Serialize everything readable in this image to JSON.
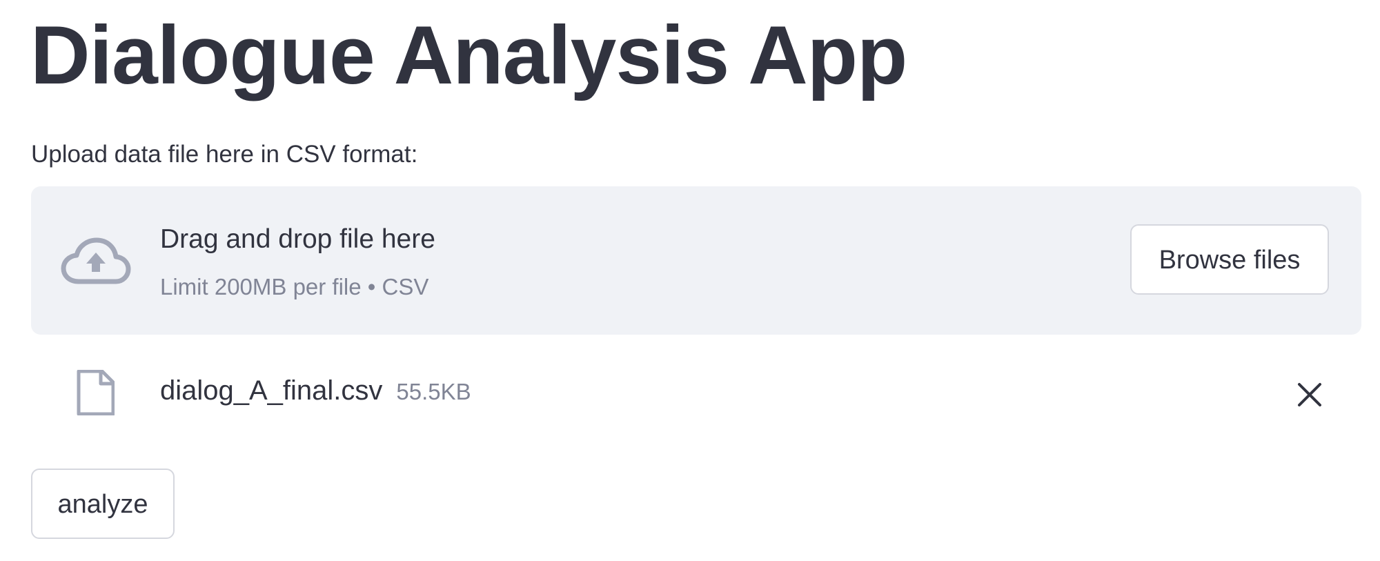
{
  "page": {
    "title": "Dialogue Analysis App"
  },
  "uploader": {
    "label": "Upload data file here in CSV format:",
    "dropzone_title": "Drag and drop file here",
    "dropzone_subtitle": "Limit 200MB per file • CSV",
    "browse_label": "Browse files",
    "icon": "cloud-upload-icon"
  },
  "uploaded_file": {
    "name": "dialog_A_final.csv",
    "size": "55.5KB",
    "icon": "file-icon",
    "remove_icon": "close-icon"
  },
  "actions": {
    "analyze_label": "analyze"
  },
  "colors": {
    "text": "#31333f",
    "muted": "#808495",
    "dropzone_bg": "#f0f2f6",
    "icon": "#a3a8b8",
    "border": "#d5d7de"
  }
}
